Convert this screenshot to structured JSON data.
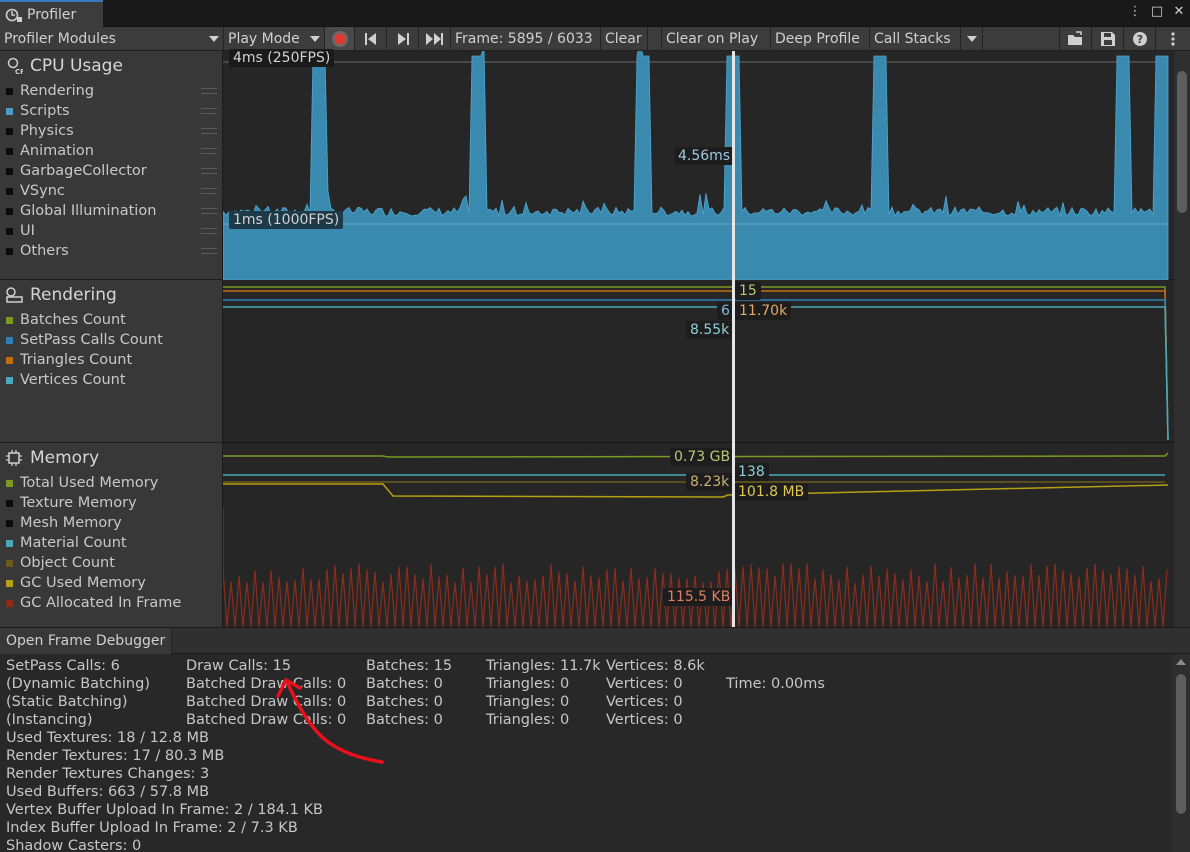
{
  "window": {
    "tab_title": "Profiler",
    "menu_btn": "⋮",
    "maximize_btn": "□",
    "close_btn": "✕"
  },
  "toolbar": {
    "modules_dropdown": "Profiler Modules",
    "mode_dropdown": "Play Mode",
    "frame_label": "Frame: 5895 / 6033",
    "clear": "Clear",
    "clear_on_play": "Clear on Play",
    "deep_profile": "Deep Profile",
    "call_stacks": "Call Stacks"
  },
  "modules": {
    "cpu": {
      "title": "CPU Usage",
      "items": [
        {
          "label": "Rendering",
          "color": "#0d0d0d"
        },
        {
          "label": "Scripts",
          "color": "#4d9ac9"
        },
        {
          "label": "Physics",
          "color": "#0d0d0d"
        },
        {
          "label": "Animation",
          "color": "#0d0d0d"
        },
        {
          "label": "GarbageCollector",
          "color": "#0d0d0d"
        },
        {
          "label": "VSync",
          "color": "#0d0d0d"
        },
        {
          "label": "Global Illumination",
          "color": "#0d0d0d"
        },
        {
          "label": "UI",
          "color": "#0d0d0d"
        },
        {
          "label": "Others",
          "color": "#0d0d0d"
        }
      ],
      "label_top": "4ms (250FPS)",
      "label_mid": "1ms (1000FPS)",
      "cursor_value": "4.56ms"
    },
    "rendering": {
      "title": "Rendering",
      "items": [
        {
          "label": "Batches Count",
          "color": "#7a9a23"
        },
        {
          "label": "SetPass Calls Count",
          "color": "#2f7fb4"
        },
        {
          "label": "Triangles Count",
          "color": "#c16e10"
        },
        {
          "label": "Vertices Count",
          "color": "#4aa8ba"
        }
      ],
      "values": {
        "batches": "15",
        "setpass": "6",
        "triangles": "11.70k",
        "vertices": "8.55k"
      }
    },
    "memory": {
      "title": "Memory",
      "items": [
        {
          "label": "Total Used Memory",
          "color": "#7a9a23"
        },
        {
          "label": "Texture Memory",
          "color": "#0d0d0d"
        },
        {
          "label": "Mesh Memory",
          "color": "#0d0d0d"
        },
        {
          "label": "Material Count",
          "color": "#4aa8ba"
        },
        {
          "label": "Object Count",
          "color": "#6b5a1c"
        },
        {
          "label": "GC Used Memory",
          "color": "#b8a015"
        },
        {
          "label": "GC Allocated In Frame",
          "color": "#8a2e1c"
        }
      ],
      "values": {
        "total": "0.73 GB",
        "material": "138",
        "object": "8.23k",
        "gc_used": "101.8 MB",
        "gc_alloc": "115.5 KB"
      }
    }
  },
  "frame_debugger_btn": "Open Frame Debugger",
  "details": {
    "rows": [
      [
        "SetPass Calls: 6",
        "Draw Calls: 15",
        "Batches: 15",
        "Triangles: 11.7k",
        "Vertices: 8.6k",
        ""
      ],
      [
        "(Dynamic Batching)",
        "Batched Draw Calls: 0",
        "Batches: 0",
        "Triangles: 0",
        "Vertices: 0",
        "Time: 0.00ms"
      ],
      [
        "(Static Batching)",
        "Batched Draw Calls: 0",
        "Batches: 0",
        "Triangles: 0",
        "Vertices: 0",
        ""
      ],
      [
        "(Instancing)",
        "Batched Draw Calls: 0",
        "Batches: 0",
        "Triangles: 0",
        "Vertices: 0",
        ""
      ]
    ],
    "lines": [
      "Used Textures: 18 / 12.8 MB",
      "Render Textures: 17 / 80.3 MB",
      "Render Textures Changes: 3",
      "Used Buffers: 663 / 57.8 MB",
      "Vertex Buffer Upload In Frame: 2 / 184.1 KB",
      "Index Buffer Upload In Frame: 2 / 7.3 KB",
      "Shadow Casters: 0"
    ]
  },
  "annotation_color": "#e8101c"
}
